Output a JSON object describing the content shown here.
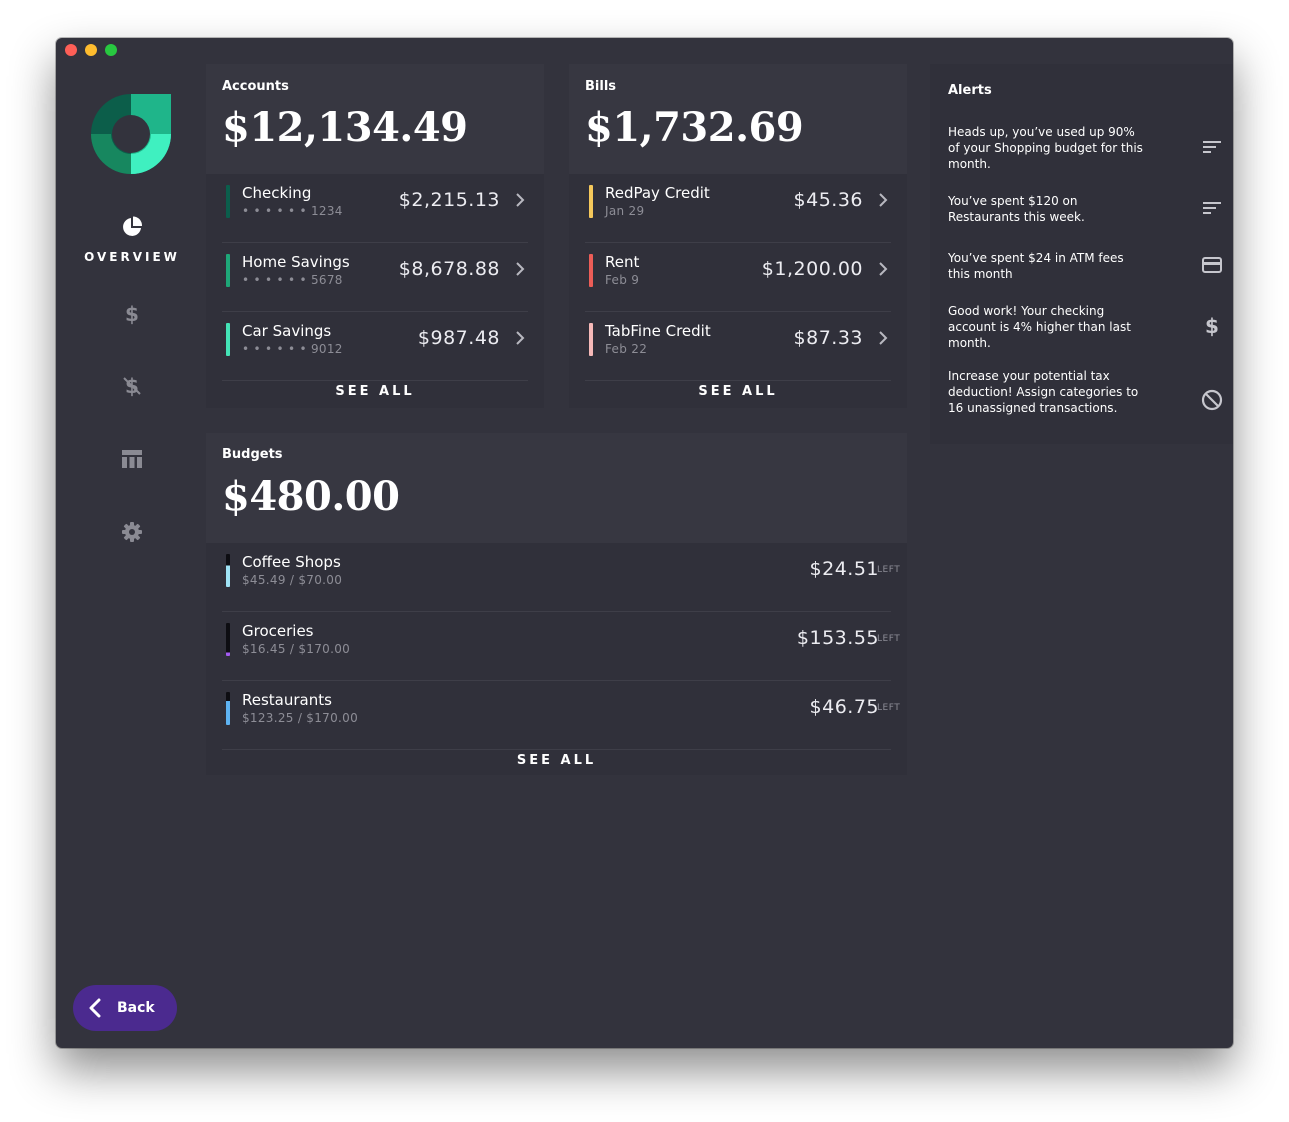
{
  "window": {
    "controls": [
      "close",
      "minimize",
      "maximize"
    ]
  },
  "sidebar": {
    "items": [
      {
        "id": "overview",
        "label": "OVERVIEW",
        "icon": "pie-chart-icon",
        "active": true
      },
      {
        "id": "transactions",
        "label": "",
        "icon": "dollar-icon",
        "glyph": "$"
      },
      {
        "id": "bills",
        "label": "",
        "icon": "dollar-strikethrough-icon",
        "glyph": "$"
      },
      {
        "id": "budgets",
        "label": "",
        "icon": "table-icon"
      },
      {
        "id": "settings",
        "label": "",
        "icon": "gear-icon"
      }
    ],
    "back_label": "Back",
    "colors": {
      "accent": "#1fb58a",
      "logo_dark": "#0c5e4a",
      "logo_light": "#3ff0c0",
      "back_bg": "#4b2a8f"
    }
  },
  "accounts": {
    "title": "Accounts",
    "total": "$12,134.49",
    "items": [
      {
        "name": "Checking",
        "sub": "• • • • • • 1234",
        "amount": "$2,215.13",
        "color": "#0b5e4c"
      },
      {
        "name": "Home Savings",
        "sub": "• • • • • • 5678",
        "amount": "$8,678.88",
        "color": "#1ea778"
      },
      {
        "name": "Car Savings",
        "sub": "• • • • • • 9012",
        "amount": "$987.48",
        "color": "#44e3b6"
      }
    ],
    "see_all": "SEE ALL"
  },
  "bills": {
    "title": "Bills",
    "total": "$1,732.69",
    "items": [
      {
        "name": "RedPay Credit",
        "sub": "Jan 29",
        "amount": "$45.36",
        "color": "#f5c85b"
      },
      {
        "name": "Rent",
        "sub": "Feb 9",
        "amount": "$1,200.00",
        "color": "#ec5d57"
      },
      {
        "name": "TabFine Credit",
        "sub": "Feb 22",
        "amount": "$87.33",
        "color": "#f6b9b8"
      }
    ],
    "see_all": "SEE ALL"
  },
  "budgets": {
    "title": "Budgets",
    "total": "$480.00",
    "items": [
      {
        "name": "Coffee Shops",
        "sub": "$45.49 / $70.00",
        "amount": "$24.51",
        "tag": "LEFT",
        "color": "#9fe3f5",
        "fraction_spent": 0.65
      },
      {
        "name": "Groceries",
        "sub": "$16.45 / $170.00",
        "amount": "$153.55",
        "tag": "LEFT",
        "color": "#a35bf0",
        "fraction_spent": 0.1
      },
      {
        "name": "Restaurants",
        "sub": "$123.25 / $170.00",
        "amount": "$46.75",
        "tag": "LEFT",
        "color": "#5eb3f2",
        "fraction_spent": 0.72
      }
    ],
    "see_all": "SEE ALL"
  },
  "alerts": {
    "title": "Alerts",
    "items": [
      {
        "text": "Heads up, you’ve used up 90% of your Shopping budget for this month.",
        "icon": "sort-lines-icon"
      },
      {
        "text": "You’ve spent $120 on Restaurants this week.",
        "icon": "sort-lines-icon"
      },
      {
        "text": "You’ve spent $24 in ATM fees this month",
        "icon": "credit-card-icon"
      },
      {
        "text": "Good work! Your checking account is 4% higher than last month.",
        "icon": "dollar-icon"
      },
      {
        "text": "Increase your potential tax deduction! Assign categories to 16 unassigned transactions.",
        "icon": "block-icon"
      }
    ]
  }
}
